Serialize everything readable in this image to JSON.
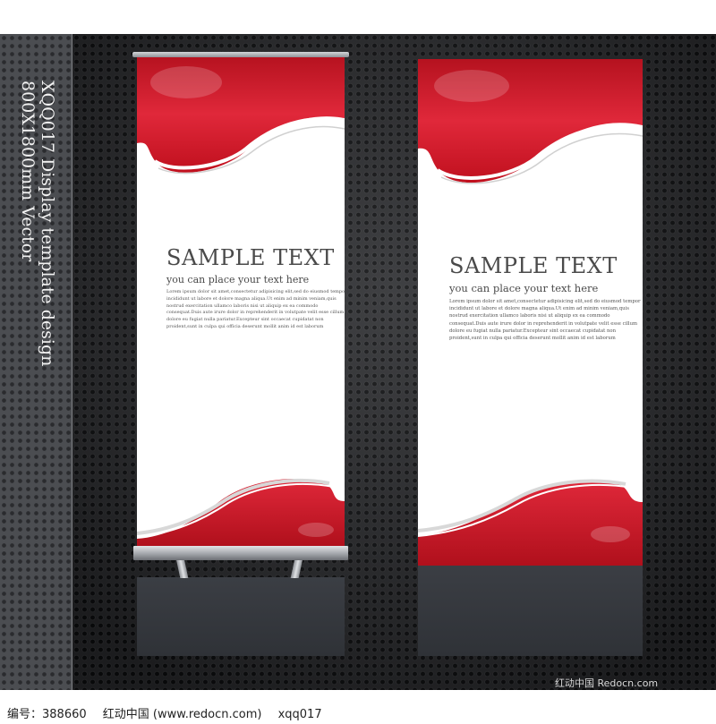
{
  "side_caption": {
    "line1": "XQQ017 Display template design",
    "line2": "800X1800mm Vector"
  },
  "banners": [
    {
      "title": "SAMPLE TEXT",
      "subtitle": "you can place your text here",
      "body": [
        "Lorem ipsum dolor sit amet,consectetur adipisicing elit,sed do eiusmod tempor",
        "incididunt ut labore et dolore magna aliqua.Ut enim ad minim veniam,quis",
        "nostrud exercitation ullamco laboris nisi ut aliquip ex ea commodo",
        "consequat.Duis aute irure dolor in reprehenderit in volutpate velit esse cillum",
        "dolore eu fugiat nulla pariatur.Excepteur sint occaecat cupidatat non",
        "proident,sunt in culpa qui officia deserunt mollit anim id est laborum"
      ]
    },
    {
      "title": "SAMPLE TEXT",
      "subtitle": "you can place your text here",
      "body": [
        "Lorem ipsum dolor sit amet,consectetur adipisicing elit,sed do eiusmod tempor",
        "incididunt ut labore et dolore magna aliqua.Ut enim ad minim veniam,quis",
        "nostrud exercitation ullamco laboris nisi ut aliquip ex ea commodo",
        "consequat.Duis aute irure dolor in reprehenderit in volutpate velit esse cillum",
        "dolore eu fugiat nulla pariatur.Excepteur sint occaecat cupidatat non",
        "proident,sunt in culpa qui officia deserunt mollit anim id est laborum"
      ]
    }
  ],
  "footer": {
    "id_text": "编号：388660",
    "site_text": "红动中国 (www.redocn.com)",
    "author_text": "xqq017"
  },
  "watermark": "红动中国 Redocn.com",
  "colors": {
    "accent_red": "#d41a2c",
    "background": "#2a2b2e"
  }
}
